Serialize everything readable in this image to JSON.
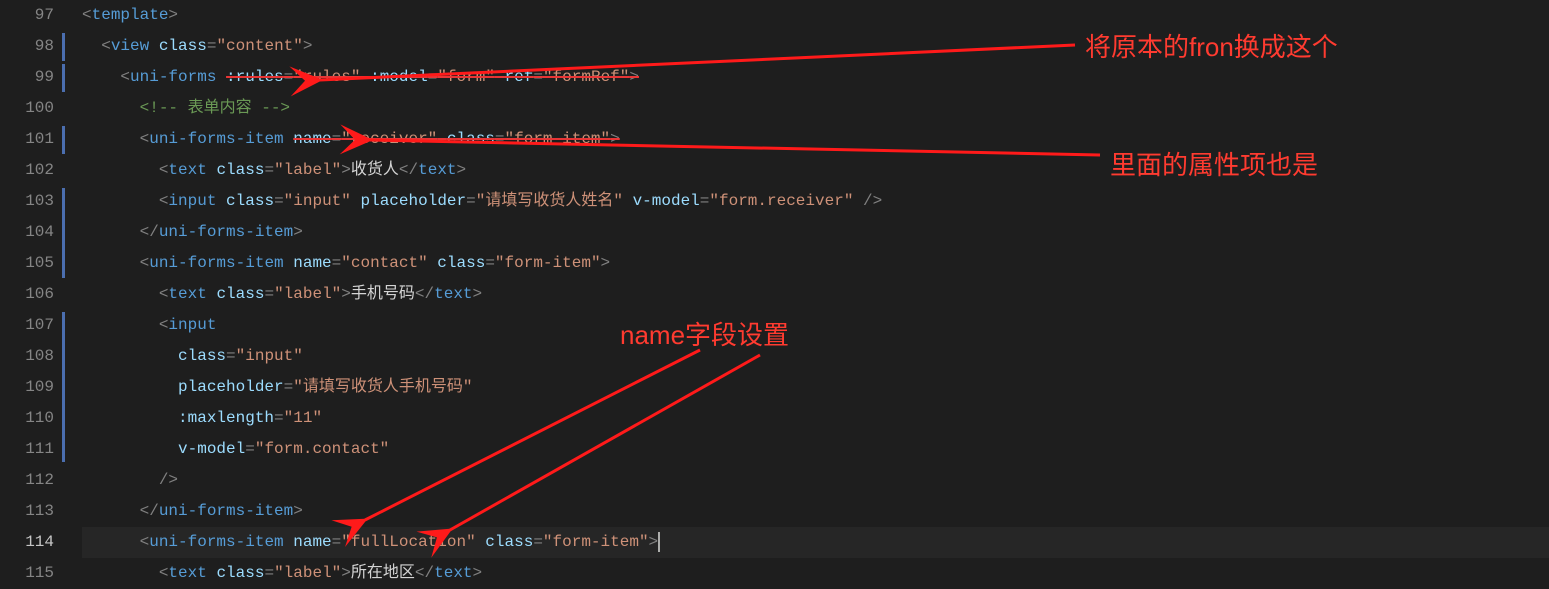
{
  "lineNumbers": [
    "97",
    "98",
    "99",
    "100",
    "101",
    "102",
    "103",
    "104",
    "105",
    "106",
    "107",
    "108",
    "109",
    "110",
    "111",
    "112",
    "113",
    "114",
    "115"
  ],
  "currentLine": "114",
  "code": {
    "l97": {
      "indent": 0,
      "raw": "<template>"
    },
    "l98": {
      "indent": 1,
      "raw": "<view class=\"content\">"
    },
    "l99": {
      "indent": 2,
      "head": "<uni-forms ",
      "struck": ":rules=\"rules\" :model=\"form\" ref=\"formRef\">"
    },
    "l100": {
      "indent": 3,
      "comment": "<!-- 表单内容 -->"
    },
    "l101": {
      "indent": 3,
      "head": "<uni-forms-item ",
      "struck": "name=\"receiver\" class=\"form-item\">"
    },
    "l102": {
      "indent": 4,
      "tag_open": "text",
      "attrs": [
        [
          "class",
          "label"
        ]
      ],
      "inner": "收货人",
      "tag_close": "text"
    },
    "l103": {
      "indent": 4,
      "tag_open": "input",
      "attrs": [
        [
          "class",
          "input"
        ],
        [
          "placeholder",
          "请填写收货人姓名"
        ],
        [
          "v-model",
          "form.receiver"
        ]
      ],
      "self_close": true
    },
    "l104": {
      "indent": 3,
      "close": "uni-forms-item"
    },
    "l105": {
      "indent": 3,
      "tag_open": "uni-forms-item",
      "attrs": [
        [
          "name",
          "contact"
        ],
        [
          "class",
          "form-item"
        ]
      ]
    },
    "l106": {
      "indent": 4,
      "tag_open": "text",
      "attrs": [
        [
          "class",
          "label"
        ]
      ],
      "inner": "手机号码",
      "tag_close": "text"
    },
    "l107": {
      "indent": 4,
      "raw_open": "<input"
    },
    "l108": {
      "indent": 5,
      "attr": [
        "class",
        "input"
      ]
    },
    "l109": {
      "indent": 5,
      "attr": [
        "placeholder",
        "请填写收货人手机号码"
      ]
    },
    "l110": {
      "indent": 5,
      "attr": [
        ":maxlength",
        "11"
      ]
    },
    "l111": {
      "indent": 5,
      "attr": [
        "v-model",
        "form.contact"
      ]
    },
    "l112": {
      "indent": 4,
      "raw_close": "/>"
    },
    "l113": {
      "indent": 3,
      "close": "uni-forms-item"
    },
    "l114": {
      "indent": 3,
      "tag_open": "uni-forms-item",
      "attrs": [
        [
          "name",
          "fullLocation"
        ],
        [
          "class",
          "form-item"
        ]
      ],
      "cursor_after": true
    },
    "l115": {
      "indent": 4,
      "tag_open": "text",
      "attrs": [
        [
          "class",
          "label"
        ]
      ],
      "inner": "所在地区",
      "tag_close": "text"
    }
  },
  "annotations": {
    "a1": "将原本的fron换成这个",
    "a2": "里面的属性项也是",
    "a3": "name字段设置"
  }
}
